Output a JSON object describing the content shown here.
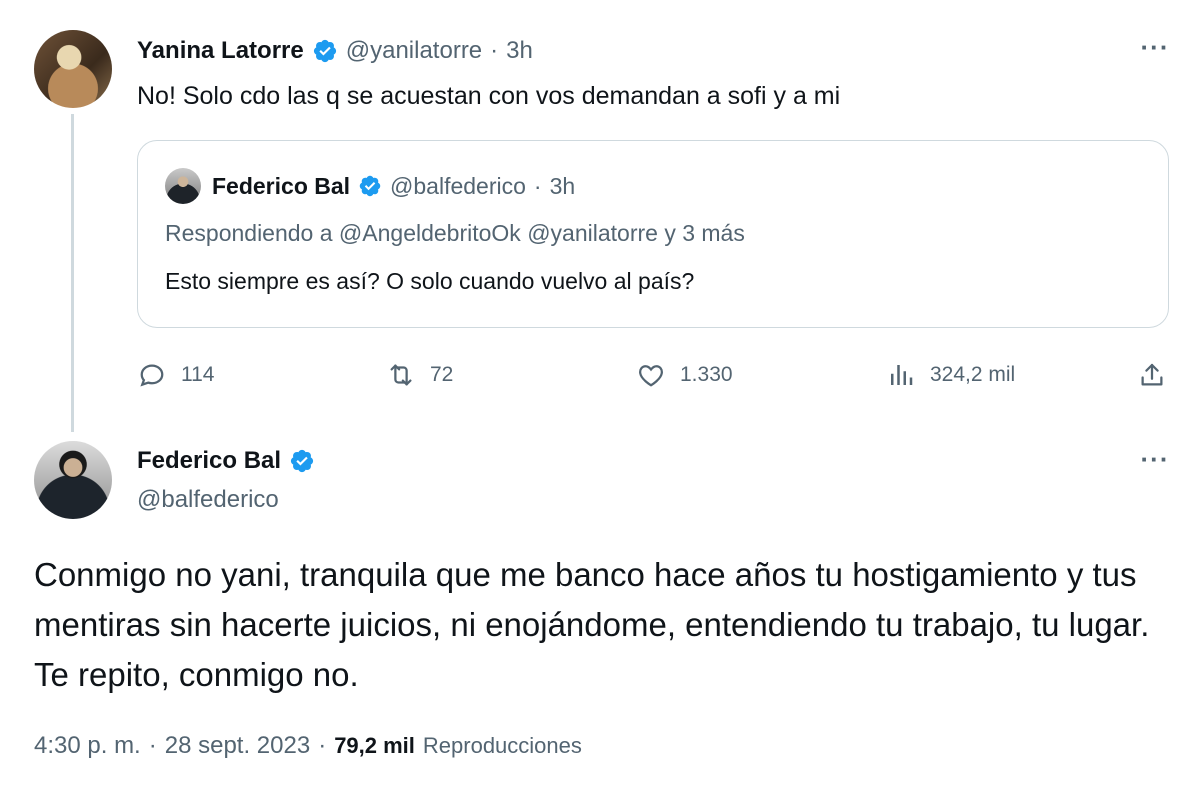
{
  "colors": {
    "verified": "#1d9bf0",
    "text": "#0f1419",
    "muted": "#536471",
    "border": "#cfd9de"
  },
  "reply_tweet": {
    "name": "Yanina Latorre",
    "handle": "@yanilatorre",
    "separator": "·",
    "time": "3h",
    "text": "No! Solo cdo las q se acuestan con vos demandan a sofi y a mi",
    "more_icon": "more-icon",
    "quoted": {
      "name": "Federico Bal",
      "handle": "@balfederico",
      "separator": "·",
      "time": "3h",
      "replying_prefix": "Respondiendo a",
      "replying_to": "@AngeldebritoOk @yanilatorre y 3 más",
      "text": "Esto siempre es así? O solo cuando vuelvo al país?"
    },
    "actions": {
      "replies": "114",
      "retweets": "72",
      "likes": "1.330",
      "views": "324,2 mil"
    }
  },
  "main_tweet": {
    "name": "Federico Bal",
    "handle": "@balfederico",
    "text": "Conmigo no yani, tranquila que me banco hace años tu hostigamiento y tus mentiras sin hacerte juicios, ni enojándome, entendiendo tu trabajo, tu lugar. Te repito, conmigo no.",
    "time": "4:30 p. m.",
    "sep1": "·",
    "date": "28 sept. 2023",
    "sep2": "·",
    "views_count": "79,2 mil",
    "views_label": "Reproducciones"
  }
}
